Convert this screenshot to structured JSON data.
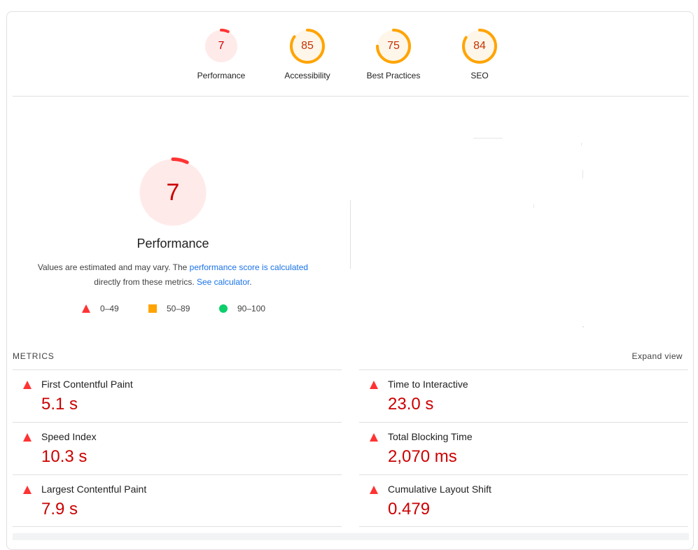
{
  "colors": {
    "fail": "#ff3333",
    "fail_text": "#cc0000",
    "fail_bg": "#ffeaea",
    "average": "#ffa400",
    "average_text": "#c33300",
    "average_bg": "#fff6ea",
    "pass": "#0cce6b",
    "link": "#1a73e8"
  },
  "gauges": [
    {
      "score": 7,
      "value": "7",
      "label": "Performance",
      "rating": "fail"
    },
    {
      "score": 85,
      "value": "85",
      "label": "Accessibility",
      "rating": "average"
    },
    {
      "score": 75,
      "value": "75",
      "label": "Best Practices",
      "rating": "average"
    },
    {
      "score": 84,
      "value": "84",
      "label": "SEO",
      "rating": "average"
    }
  ],
  "performance": {
    "score": 7,
    "value": "7",
    "title": "Performance",
    "desc_prefix": "Values are estimated and may vary. The ",
    "desc_link": "performance score is calculated",
    "desc_middle": " directly from these metrics. ",
    "desc_link2": "See calculator",
    "desc_suffix": "."
  },
  "legend": [
    {
      "shape": "triangle-icon",
      "range": "0–49"
    },
    {
      "shape": "square-icon",
      "range": "50–89"
    },
    {
      "shape": "circle-icon",
      "range": "90–100"
    }
  ],
  "metrics": {
    "header": "METRICS",
    "expand_label": "Expand view",
    "items": [
      {
        "title": "First Contentful Paint",
        "value": "5.1 s"
      },
      {
        "title": "Time to Interactive",
        "value": "23.0 s"
      },
      {
        "title": "Speed Index",
        "value": "10.3 s"
      },
      {
        "title": "Total Blocking Time",
        "value": "2,070 ms"
      },
      {
        "title": "Largest Contentful Paint",
        "value": "7.9 s"
      },
      {
        "title": "Cumulative Layout Shift",
        "value": "0.479"
      }
    ]
  }
}
